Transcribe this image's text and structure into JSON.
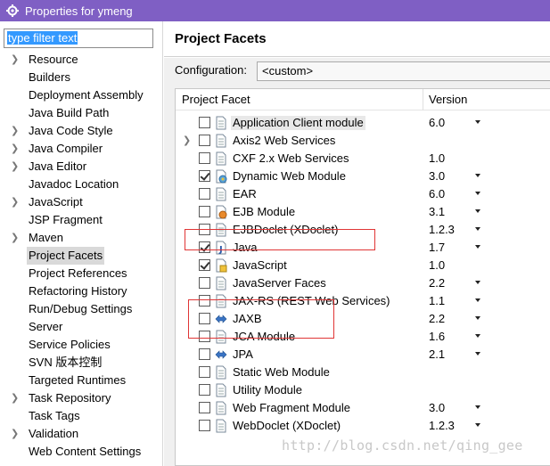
{
  "window": {
    "title": "Properties for ymeng"
  },
  "filter": {
    "value": "type filter text"
  },
  "tree": [
    {
      "label": "Resource",
      "expandable": true,
      "selected": false
    },
    {
      "label": "Builders",
      "expandable": false,
      "selected": false
    },
    {
      "label": "Deployment Assembly",
      "expandable": false,
      "selected": false
    },
    {
      "label": "Java Build Path",
      "expandable": false,
      "selected": false
    },
    {
      "label": "Java Code Style",
      "expandable": true,
      "selected": false
    },
    {
      "label": "Java Compiler",
      "expandable": true,
      "selected": false
    },
    {
      "label": "Java Editor",
      "expandable": true,
      "selected": false
    },
    {
      "label": "Javadoc Location",
      "expandable": false,
      "selected": false
    },
    {
      "label": "JavaScript",
      "expandable": true,
      "selected": false
    },
    {
      "label": "JSP Fragment",
      "expandable": false,
      "selected": false
    },
    {
      "label": "Maven",
      "expandable": true,
      "selected": false
    },
    {
      "label": "Project Facets",
      "expandable": false,
      "selected": true
    },
    {
      "label": "Project References",
      "expandable": false,
      "selected": false
    },
    {
      "label": "Refactoring History",
      "expandable": false,
      "selected": false
    },
    {
      "label": "Run/Debug Settings",
      "expandable": false,
      "selected": false
    },
    {
      "label": "Server",
      "expandable": false,
      "selected": false
    },
    {
      "label": "Service Policies",
      "expandable": false,
      "selected": false
    },
    {
      "label": "SVN 版本控制",
      "expandable": false,
      "selected": false
    },
    {
      "label": "Targeted Runtimes",
      "expandable": false,
      "selected": false
    },
    {
      "label": "Task Repository",
      "expandable": true,
      "selected": false
    },
    {
      "label": "Task Tags",
      "expandable": false,
      "selected": false
    },
    {
      "label": "Validation",
      "expandable": true,
      "selected": false
    },
    {
      "label": "Web Content Settings",
      "expandable": false,
      "selected": false
    }
  ],
  "page": {
    "title": "Project Facets"
  },
  "configuration": {
    "label": "Configuration:",
    "value": "<custom>"
  },
  "table": {
    "col_facet": "Project Facet",
    "col_version": "Version",
    "rows": [
      {
        "name": "Application Client module",
        "version": "6.0",
        "checked": false,
        "dropdown": true,
        "expandable": false,
        "highlight": true,
        "icon": "page-icon"
      },
      {
        "name": "Axis2 Web Services",
        "version": "",
        "checked": false,
        "dropdown": false,
        "expandable": true,
        "highlight": false,
        "icon": "page-icon"
      },
      {
        "name": "CXF 2.x Web Services",
        "version": "1.0",
        "checked": false,
        "dropdown": false,
        "expandable": false,
        "highlight": false,
        "icon": "page-icon"
      },
      {
        "name": "Dynamic Web Module",
        "version": "3.0",
        "checked": true,
        "dropdown": true,
        "expandable": false,
        "highlight": false,
        "icon": "web-module-icon"
      },
      {
        "name": "EAR",
        "version": "6.0",
        "checked": false,
        "dropdown": true,
        "expandable": false,
        "highlight": false,
        "icon": "page-icon"
      },
      {
        "name": "EJB Module",
        "version": "3.1",
        "checked": false,
        "dropdown": true,
        "expandable": false,
        "highlight": false,
        "icon": "ejb-icon"
      },
      {
        "name": "EJBDoclet (XDoclet)",
        "version": "1.2.3",
        "checked": false,
        "dropdown": true,
        "expandable": false,
        "highlight": false,
        "icon": "page-icon"
      },
      {
        "name": "Java",
        "version": "1.7",
        "checked": true,
        "dropdown": true,
        "expandable": false,
        "highlight": false,
        "icon": "java-icon"
      },
      {
        "name": "JavaScript",
        "version": "1.0",
        "checked": true,
        "dropdown": false,
        "expandable": false,
        "highlight": false,
        "icon": "javascript-icon"
      },
      {
        "name": "JavaServer Faces",
        "version": "2.2",
        "checked": false,
        "dropdown": true,
        "expandable": false,
        "highlight": false,
        "icon": "page-icon"
      },
      {
        "name": "JAX-RS (REST Web Services)",
        "version": "1.1",
        "checked": false,
        "dropdown": true,
        "expandable": false,
        "highlight": false,
        "icon": "page-icon"
      },
      {
        "name": "JAXB",
        "version": "2.2",
        "checked": false,
        "dropdown": true,
        "expandable": false,
        "highlight": false,
        "icon": "jaxb-icon"
      },
      {
        "name": "JCA Module",
        "version": "1.6",
        "checked": false,
        "dropdown": true,
        "expandable": false,
        "highlight": false,
        "icon": "page-icon"
      },
      {
        "name": "JPA",
        "version": "2.1",
        "checked": false,
        "dropdown": true,
        "expandable": false,
        "highlight": false,
        "icon": "jaxb-icon"
      },
      {
        "name": "Static Web Module",
        "version": "",
        "checked": false,
        "dropdown": false,
        "expandable": false,
        "highlight": false,
        "icon": "page-icon"
      },
      {
        "name": "Utility Module",
        "version": "",
        "checked": false,
        "dropdown": false,
        "expandable": false,
        "highlight": false,
        "icon": "page-icon"
      },
      {
        "name": "Web Fragment Module",
        "version": "3.0",
        "checked": false,
        "dropdown": true,
        "expandable": false,
        "highlight": false,
        "icon": "page-icon"
      },
      {
        "name": "WebDoclet (XDoclet)",
        "version": "1.2.3",
        "checked": false,
        "dropdown": true,
        "expandable": false,
        "highlight": false,
        "icon": "page-icon"
      }
    ]
  },
  "watermark": "http://blog.csdn.net/qing_gee",
  "colors": {
    "titlebar": "#7f5fc4",
    "highlight_box": "#e03535",
    "selection": "#3399ff"
  }
}
